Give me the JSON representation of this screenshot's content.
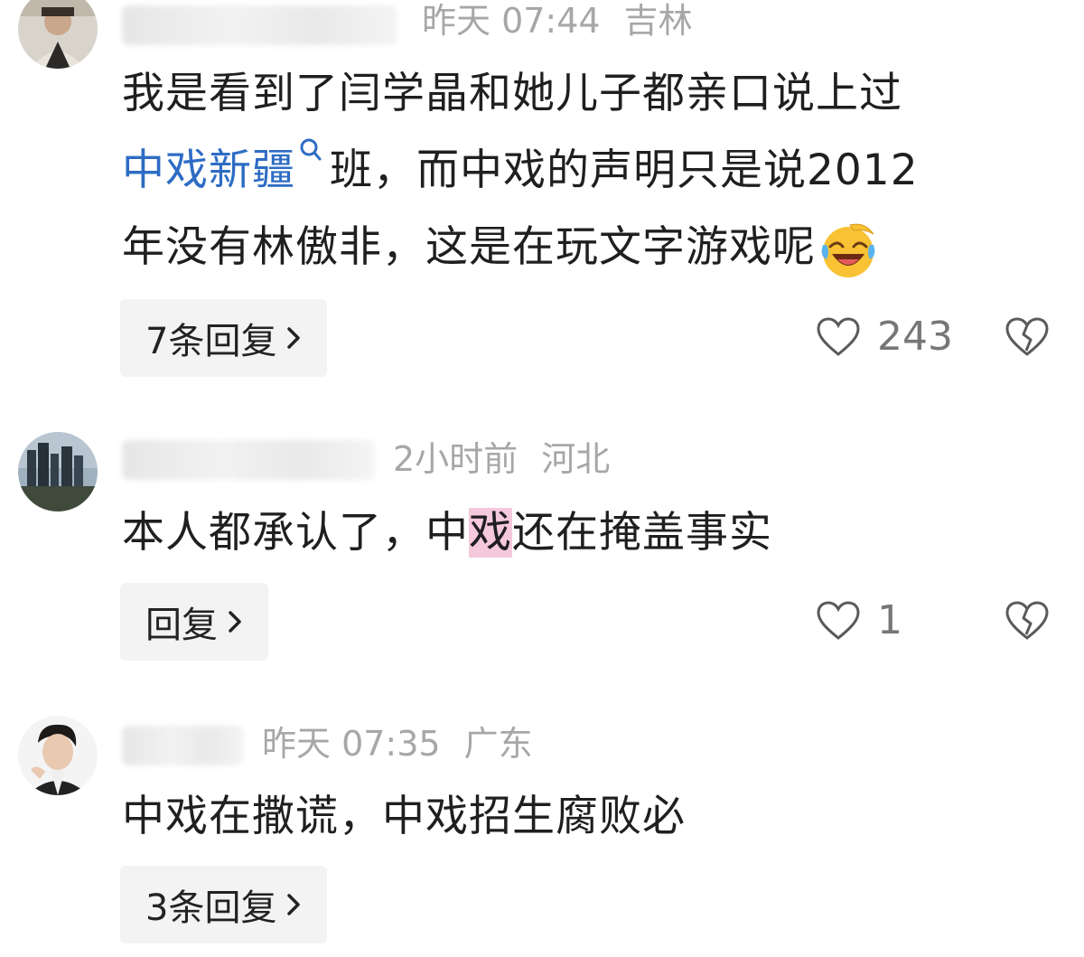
{
  "comments": [
    {
      "time": "昨天 07:44",
      "location": "吉林",
      "text_lines": [
        [
          "我是看到了闫学晶和她儿子都亲口说上过"
        ],
        [
          "中戏新疆",
          "班，而中戏的声明只是说2012"
        ],
        [
          "年没有林傲非，这是在玩文字游戏呢"
        ]
      ],
      "reply_label": "7条回复",
      "likes": "243",
      "emoji": "laughing-crying-emoji"
    },
    {
      "time": "2小时前",
      "location": "河北",
      "text_parts": [
        "本人都承认了，中",
        "戏",
        "还在掩盖事实"
      ],
      "reply_label": "回复",
      "likes": "1"
    },
    {
      "time": "昨天 07:35",
      "location": "广东",
      "text": "中戏在撒谎，中戏招生腐败必",
      "reply_label": "3条回复"
    }
  ],
  "colors": {
    "link": "#2d6cc4",
    "highlight": "#f5c8dc",
    "meta": "#a7a7a7"
  },
  "icons": [
    "heart-outline-icon",
    "broken-heart-icon",
    "chevron-right-icon",
    "search-icon"
  ]
}
